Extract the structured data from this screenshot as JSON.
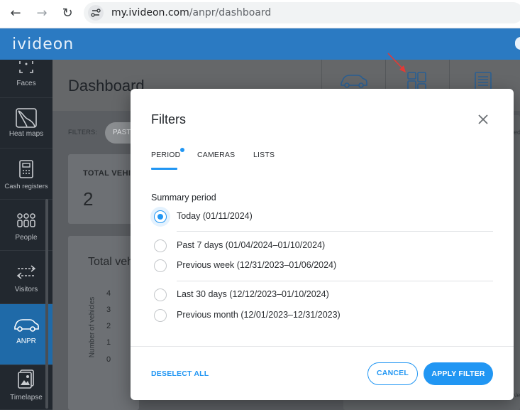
{
  "browser": {
    "url_host": "my.ivideon.com",
    "url_path": "/anpr/dashboard"
  },
  "app": {
    "logo": "ivideon"
  },
  "sidebar": {
    "items": [
      {
        "label": "Faces",
        "icon": "face-scan-icon"
      },
      {
        "label": "Heat maps",
        "icon": "heat-map-icon"
      },
      {
        "label": "Cash registers",
        "icon": "cash-register-icon"
      },
      {
        "label": "People",
        "icon": "people-icon"
      },
      {
        "label": "Visitors",
        "icon": "visitors-arrows-icon"
      },
      {
        "label": "ANPR",
        "icon": "car-icon",
        "active": true
      },
      {
        "label": "Timelapse",
        "icon": "timelapse-icon"
      }
    ]
  },
  "dashboard": {
    "title": "Dashboard",
    "filters_label": "FILTERS:",
    "filter_chip": "PAST",
    "total_card_label": "TOTAL VEHICL",
    "total_card_value": "2",
    "chart_title": "Total vehi",
    "y_axis_label": "Number of vehicles",
    "y_ticks": [
      "4",
      "3",
      "2",
      "1",
      "0"
    ],
    "right_hint_1": "ed",
    "right_hint_2": "Ne"
  },
  "modal": {
    "title": "Filters",
    "tabs": [
      {
        "label": "PERIOD",
        "active": true
      },
      {
        "label": "CAMERAS"
      },
      {
        "label": "LISTS"
      }
    ],
    "section_label": "Summary period",
    "options": [
      {
        "label": "Today (01/11/2024)",
        "checked": true
      },
      {
        "label": "Past 7 days (01/04/2024–01/10/2024)"
      },
      {
        "label": "Previous week (12/31/2023–01/06/2024)"
      },
      {
        "label": "Last 30 days (12/12/2023–01/10/2024)"
      },
      {
        "label": "Previous month (12/01/2023–12/31/2023)"
      }
    ],
    "deselect_label": "DESELECT ALL",
    "cancel_label": "CANCEL",
    "apply_label": "APPLY FILTER"
  },
  "colors": {
    "accent": "#2196f3",
    "appbar": "#2b7ac2",
    "sidebar": "#22282f",
    "annotation_arrow": "#e53935"
  }
}
